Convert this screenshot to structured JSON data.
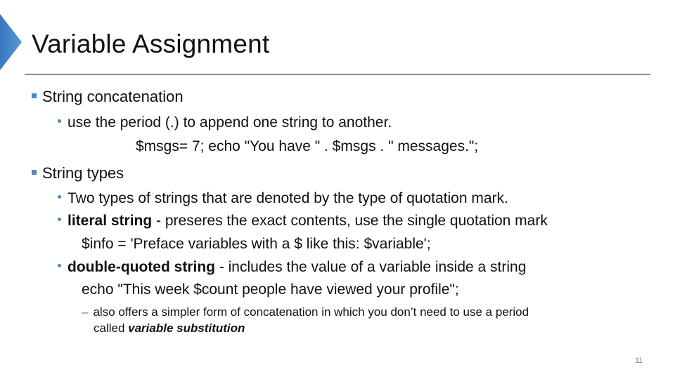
{
  "slide": {
    "title": "Variable Assignment",
    "accent_color": "#4a86c5",
    "page_number": "11"
  },
  "content": {
    "section1": {
      "heading": "String concatenation",
      "bullet1": "use the period (.) to append one string to another.",
      "code1": "$msgs= 7; echo \"You have \" . $msgs . \" messages.\";"
    },
    "section2": {
      "heading": "String types",
      "bullet1": "Two types of strings that are denoted by the type of quotation mark.",
      "bullet2_bold": "literal string",
      "bullet2_rest": " - preseres the exact contents, use the single quotation mark",
      "code2": "$info = 'Preface variables with a $ like this: $variable';",
      "bullet3_bold": "double-quoted string",
      "bullet3_rest": " - includes the value of a variable inside a string",
      "code3": "echo \"This week $count people have viewed your profile\";",
      "sub1_line1": "also offers a simpler form of concatenation in which you don’t need to use a period",
      "sub1_line2_prefix": "called ",
      "sub1_line2_emph": "variable substitution"
    }
  }
}
